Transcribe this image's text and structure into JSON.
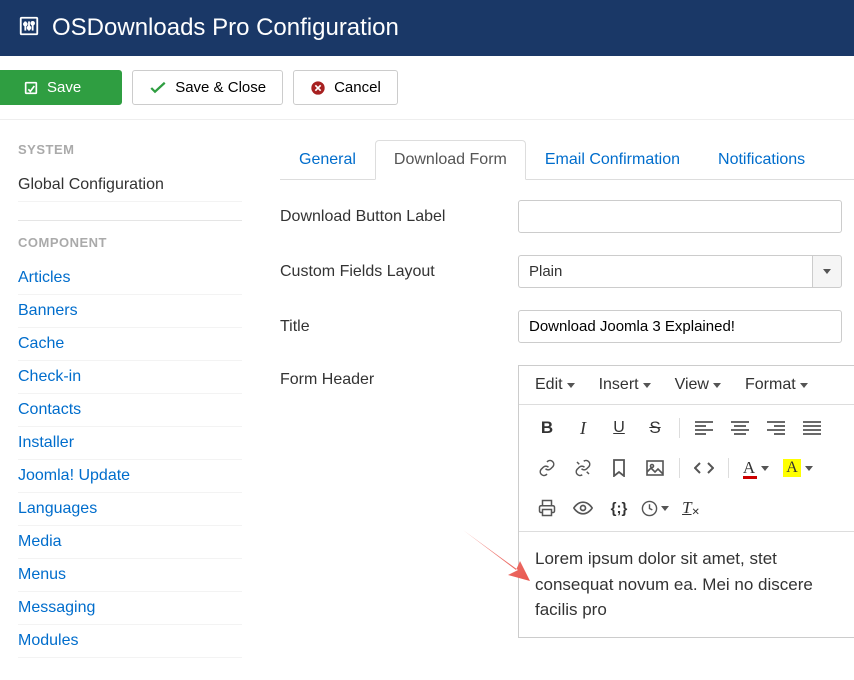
{
  "header": {
    "title": "OSDownloads Pro Configuration"
  },
  "toolbar": {
    "save": "Save",
    "save_close": "Save & Close",
    "cancel": "Cancel"
  },
  "sidebar": {
    "system_heading": "SYSTEM",
    "global_config": "Global Configuration",
    "component_heading": "COMPONENT",
    "items": [
      "Articles",
      "Banners",
      "Cache",
      "Check-in",
      "Contacts",
      "Installer",
      "Joomla! Update",
      "Languages",
      "Media",
      "Menus",
      "Messaging",
      "Modules"
    ]
  },
  "tabs": {
    "general": "General",
    "download_form": "Download Form",
    "email_confirmation": "Email Confirmation",
    "notifications": "Notifications"
  },
  "form": {
    "download_button_label": {
      "label": "Download Button Label",
      "value": ""
    },
    "custom_fields_layout": {
      "label": "Custom Fields Layout",
      "value": "Plain"
    },
    "title": {
      "label": "Title",
      "value": "Download Joomla 3 Explained!"
    },
    "form_header": {
      "label": "Form Header"
    }
  },
  "editor": {
    "menus": {
      "edit": "Edit",
      "insert": "Insert",
      "view": "View",
      "format": "Format"
    },
    "content": "Lorem ipsum dolor sit amet, stet consequat novum ea. Mei no discere facilis pro"
  }
}
